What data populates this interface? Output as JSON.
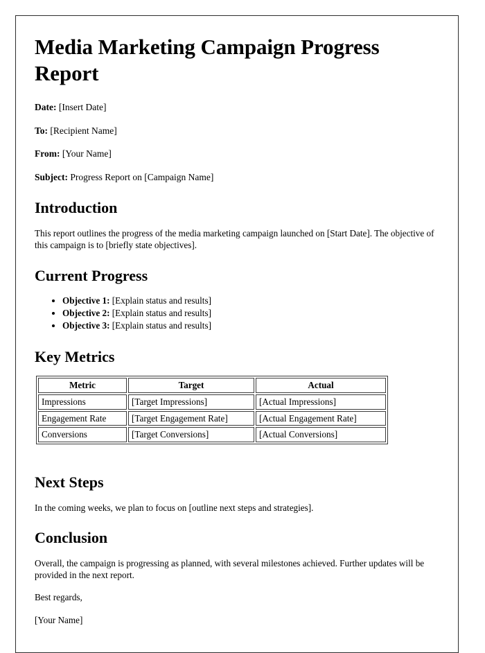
{
  "document": {
    "title": "Media Marketing Campaign Progress Report",
    "meta": {
      "date_label": "Date:",
      "date_value": "[Insert Date]",
      "to_label": "To:",
      "to_value": "[Recipient Name]",
      "from_label": "From:",
      "from_value": "[Your Name]",
      "subject_label": "Subject:",
      "subject_value": "Progress Report on [Campaign Name]"
    },
    "sections": {
      "introduction": {
        "heading": "Introduction",
        "paragraph": "This report outlines the progress of the media marketing campaign launched on [Start Date]. The objective of this campaign is to [briefly state objectives]."
      },
      "current_progress": {
        "heading": "Current Progress",
        "items": [
          {
            "label": "Objective 1:",
            "text": "[Explain status and results]"
          },
          {
            "label": "Objective 2:",
            "text": "[Explain status and results]"
          },
          {
            "label": "Objective 3:",
            "text": "[Explain status and results]"
          }
        ]
      },
      "key_metrics": {
        "heading": "Key Metrics",
        "columns": [
          "Metric",
          "Target",
          "Actual"
        ],
        "rows": [
          [
            "Impressions",
            "[Target Impressions]",
            "[Actual Impressions]"
          ],
          [
            "Engagement Rate",
            "[Target Engagement Rate]",
            "[Actual Engagement Rate]"
          ],
          [
            "Conversions",
            "[Target Conversions]",
            "[Actual Conversions]"
          ]
        ]
      },
      "next_steps": {
        "heading": "Next Steps",
        "paragraph": "In the coming weeks, we plan to focus on [outline next steps and strategies]."
      },
      "conclusion": {
        "heading": "Conclusion",
        "paragraph": "Overall, the campaign is progressing as planned, with several milestones achieved. Further updates will be provided in the next report.",
        "signoff": "Best regards,",
        "signature": "[Your Name]"
      }
    }
  }
}
